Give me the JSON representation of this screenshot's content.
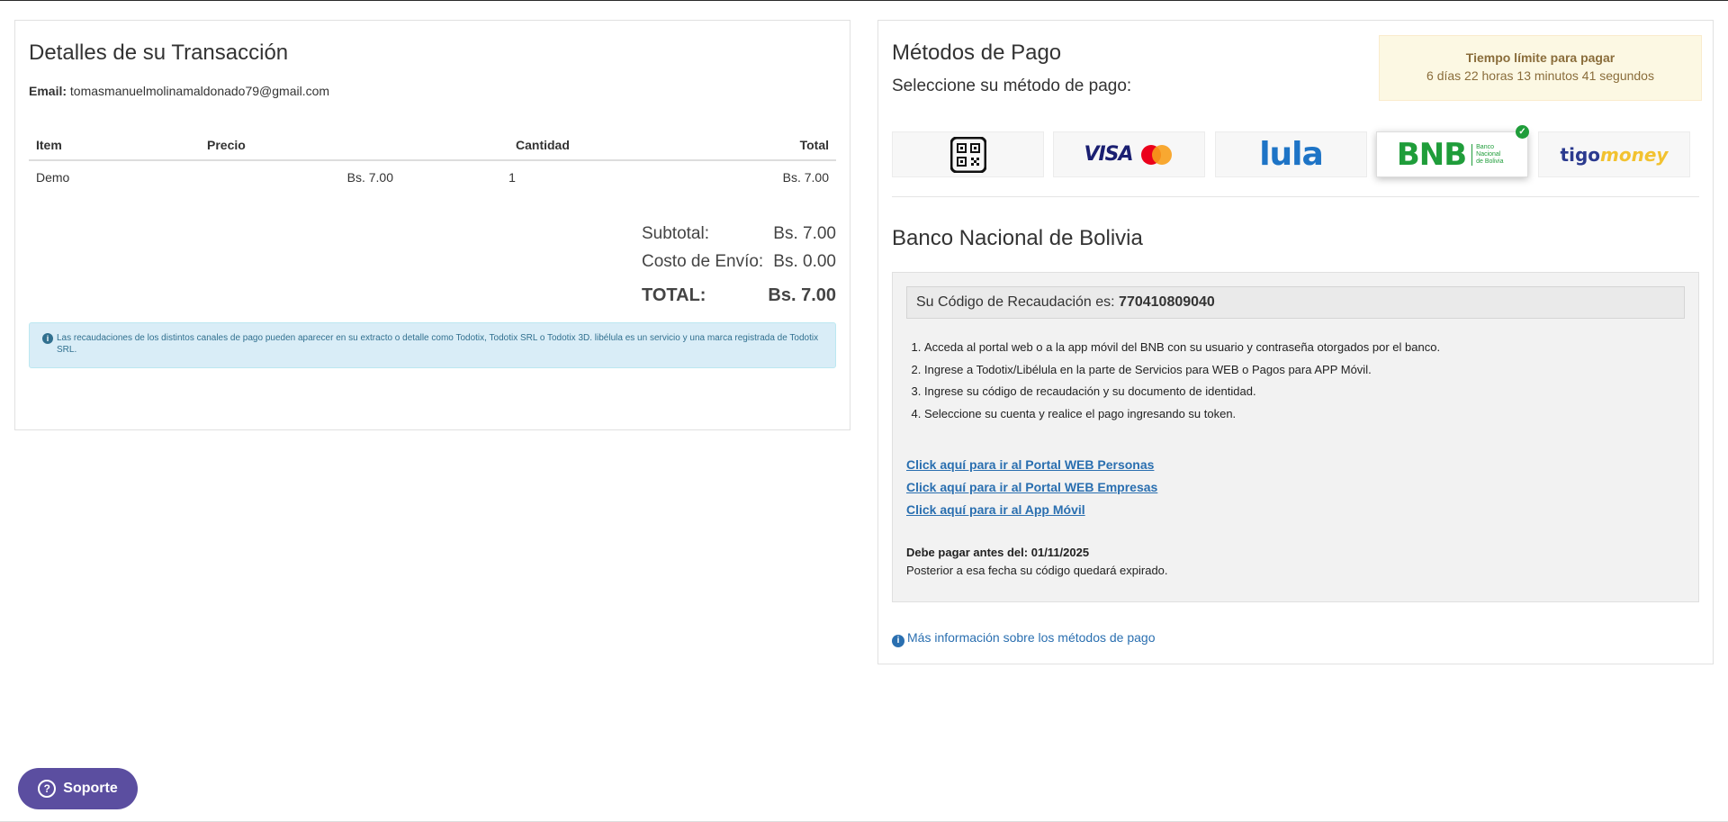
{
  "transaction": {
    "title": "Detalles de su Transacción",
    "email_label": "Email:",
    "email": "tomasmanuelmolinamaldonado79@gmail.com",
    "table": {
      "headers": {
        "item": "Item",
        "precio": "Precio",
        "cantidad": "Cantidad",
        "total": "Total"
      },
      "rows": [
        {
          "item": "Demo",
          "precio": "Bs. 7.00",
          "cantidad": "1",
          "total": "Bs. 7.00"
        }
      ]
    },
    "subtotal_label": "Subtotal:",
    "subtotal": "Bs. 7.00",
    "envio_label": "Costo de Envío:",
    "envio": "Bs. 0.00",
    "total_label": "TOTAL:",
    "total": "Bs. 7.00",
    "notice": "Las recaudaciones de los distintos canales de pago pueden aparecer en su extracto o detalle como Todotix, Todotix SRL o Todotix 3D. libélula es un servicio y una marca registrada de Todotix SRL."
  },
  "methods": {
    "title": "Métodos de Pago",
    "subtitle": "Seleccione su método de pago:",
    "time_title": "Tiempo límite para pagar",
    "time_value": "6 días 22 horas 13 minutos 41 segundos",
    "options": [
      {
        "name": "QR",
        "icon": "qr-code-icon"
      },
      {
        "name": "VISA / Mastercard",
        "icon": "visa-mastercard-logo"
      },
      {
        "name": "lula",
        "icon": "lula-logo"
      },
      {
        "name": "BNB",
        "icon": "bnb-logo",
        "selected": true
      },
      {
        "name": "tigo money",
        "icon": "tigo-money-logo"
      }
    ],
    "bnb_text": "BNB",
    "bnb_small": "Banco Nacional de Bolivia",
    "lula_text": "lula",
    "visa_text": "VISA",
    "tigo_text": "tigo",
    "money_text": "money"
  },
  "bank": {
    "title": "Banco Nacional de Bolivia",
    "code_label": "Su Código de Recaudación es:",
    "code": "770410809040",
    "steps": [
      "Acceda al portal web o a la app móvil del BNB con su usuario y contraseña otorgados por el banco.",
      "Ingrese a Todotix/Libélula en la parte de Servicios para WEB o Pagos para APP Móvil.",
      "Ingrese su código de recaudación y su documento de identidad.",
      "Seleccione su cuenta y realice el pago ingresando su token."
    ],
    "links": {
      "personas": "Click aquí para ir al Portal WEB Personas",
      "empresas": "Click aquí para ir al Portal WEB Empresas",
      "app": "Click aquí para ir al App Móvil"
    },
    "deadline_label": "Debe pagar antes del:",
    "deadline_date": "01/11/2025",
    "expire_note": "Posterior a esa fecha su código quedará expirado.",
    "more_info": "Más información sobre los métodos de pago"
  },
  "support": {
    "label": "Soporte"
  },
  "colors": {
    "accent": "#2a6fb0",
    "support": "#5b4ea0",
    "bnb_green": "#1f9d3a",
    "alert_bg": "#d9edf7",
    "warning_bg": "#fcf8e3"
  }
}
